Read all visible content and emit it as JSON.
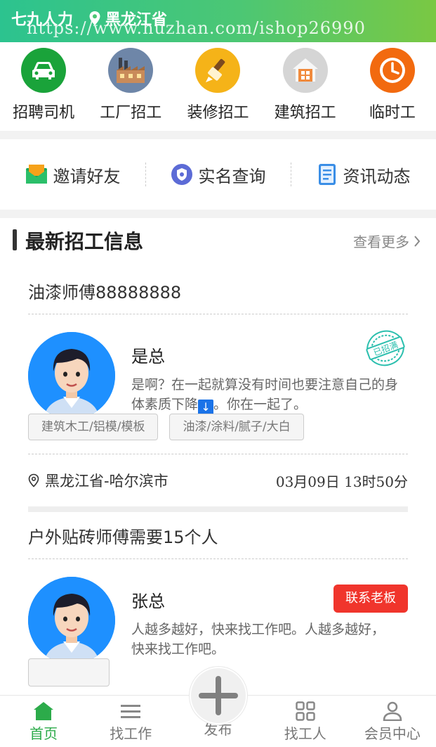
{
  "header": {
    "app_name": "七九人力",
    "location": "黑龙江省",
    "watermark": "https://www.huzhan.com/ishop26990"
  },
  "categories": [
    {
      "label": "招聘司机",
      "icon": "car-icon",
      "color": "#1aa33a"
    },
    {
      "label": "工厂招工",
      "icon": "factory-icon",
      "color": "#6e86a8"
    },
    {
      "label": "装修招工",
      "icon": "paint-brush-icon",
      "color": "#f5b318"
    },
    {
      "label": "建筑招工",
      "icon": "house-icon",
      "color": "#d5d5d5"
    },
    {
      "label": "临时工",
      "icon": "clock-icon",
      "color": "#f26a0f"
    }
  ],
  "quick_links": [
    {
      "label": "邀请好友",
      "icon": "envelope-icon"
    },
    {
      "label": "实名查询",
      "icon": "shield-icon"
    },
    {
      "label": "资讯动态",
      "icon": "document-icon"
    }
  ],
  "section": {
    "title": "最新招工信息",
    "more": "查看更多"
  },
  "jobs": [
    {
      "title": "油漆师傅88888888",
      "boss": "是总",
      "message_before": "是啊？在一起就算没有时间也要注意自己的身体素质下降",
      "message_arrow": "↓",
      "message_after": "。你在一起了。",
      "stamp": "已招满",
      "tags": [
        "建筑木工/铝模/模板",
        "油漆/涂料/腻子/大白"
      ],
      "location": "黑龙江省-哈尔滨市",
      "time": "03月09日 13时50分"
    },
    {
      "title": "户外贴砖师傅需要15个人",
      "boss": "张总",
      "message": "人越多越好，快来找工作吧。人越多越好，快来找工作吧。",
      "contact_label": "联系老板"
    }
  ],
  "nav": {
    "items": [
      {
        "label": "首页",
        "icon": "home-icon",
        "active": true
      },
      {
        "label": "找工作",
        "icon": "menu-icon",
        "active": false
      },
      {
        "label": "发布",
        "icon": "plus-icon",
        "active": false
      },
      {
        "label": "找工人",
        "icon": "grid-icon",
        "active": false
      },
      {
        "label": "会员中心",
        "icon": "user-icon",
        "active": false
      }
    ]
  }
}
